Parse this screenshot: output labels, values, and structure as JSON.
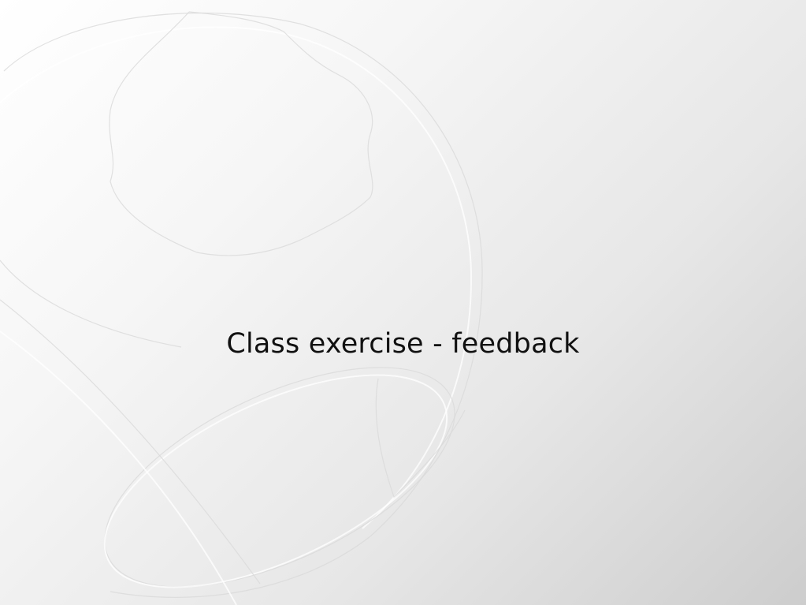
{
  "slide": {
    "title": "Class exercise - feedback",
    "background_graphic": "globe-outline"
  }
}
